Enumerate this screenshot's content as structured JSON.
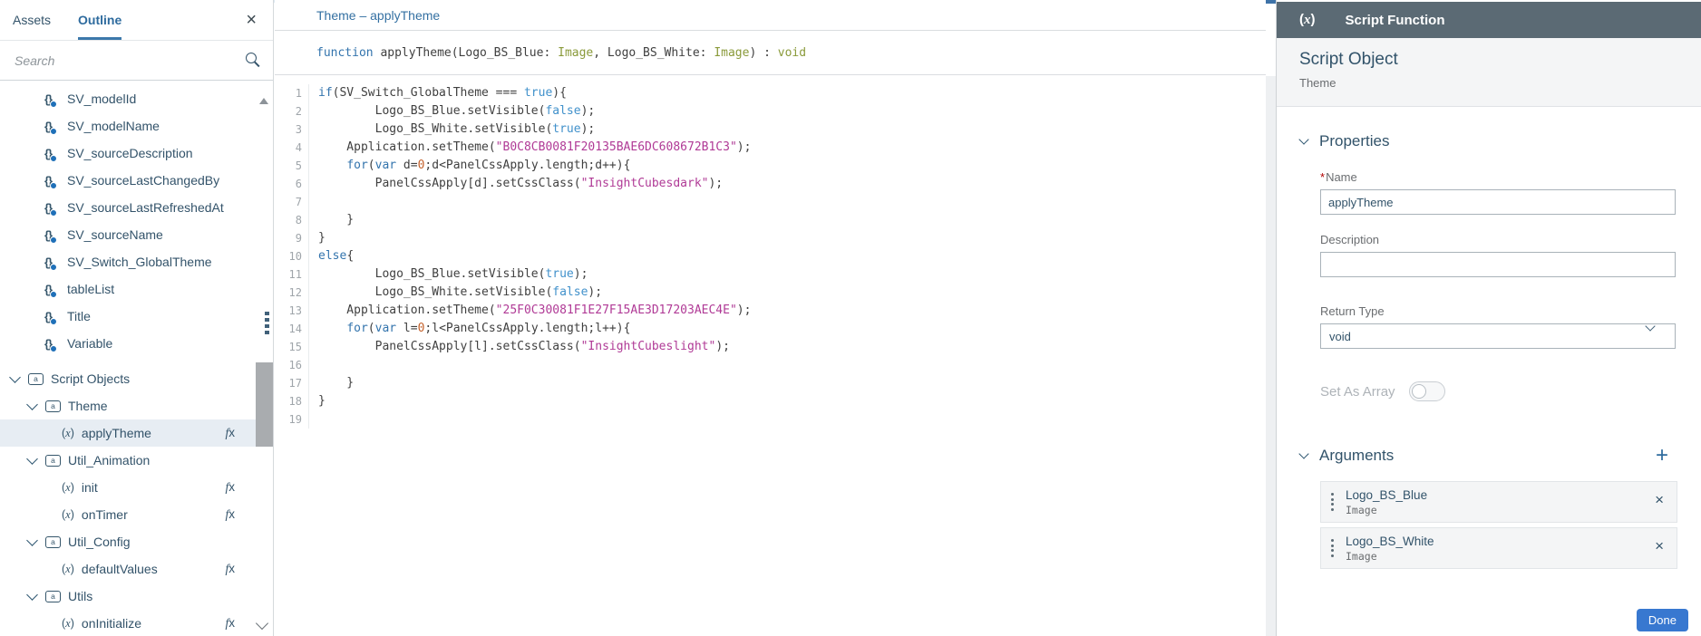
{
  "icons": {
    "variable": "{}",
    "object": "a",
    "function_open": "(",
    "function_x": "x",
    "function_close": ")",
    "fx_f": "f",
    "fx_x": "x",
    "remove": "×"
  },
  "sidebar": {
    "tabs": [
      {
        "label": "Assets",
        "active": false
      },
      {
        "label": "Outline",
        "active": true
      }
    ],
    "close_icon": "×",
    "search": {
      "placeholder": "Search"
    },
    "tree": [
      {
        "indent": 1,
        "icon": "variable",
        "label": "SV_modelId"
      },
      {
        "indent": 1,
        "icon": "variable",
        "label": "SV_modelName"
      },
      {
        "indent": 1,
        "icon": "variable",
        "label": "SV_sourceDescription"
      },
      {
        "indent": 1,
        "icon": "variable",
        "label": "SV_sourceLastChangedBy"
      },
      {
        "indent": 1,
        "icon": "variable",
        "label": "SV_sourceLastRefreshedAt"
      },
      {
        "indent": 1,
        "icon": "variable",
        "label": "SV_sourceName"
      },
      {
        "indent": 1,
        "icon": "variable",
        "label": "SV_Switch_GlobalTheme"
      },
      {
        "indent": 1,
        "icon": "variable",
        "label": "tableList"
      },
      {
        "indent": 1,
        "icon": "variable",
        "label": "Title"
      },
      {
        "indent": 1,
        "icon": "variable",
        "label": "Variable"
      },
      {
        "indent": 0,
        "chevron": true,
        "icon": "object",
        "label": "Script Objects",
        "gap": true
      },
      {
        "indent": 1,
        "chevron": true,
        "icon": "object",
        "label": "Theme"
      },
      {
        "indent": 2,
        "icon": "function",
        "label": "applyTheme",
        "fx": true,
        "selected": true
      },
      {
        "indent": 1,
        "chevron": true,
        "icon": "object",
        "label": "Util_Animation"
      },
      {
        "indent": 2,
        "icon": "function",
        "label": "init",
        "fx": true
      },
      {
        "indent": 2,
        "icon": "function",
        "label": "onTimer",
        "fx": true
      },
      {
        "indent": 1,
        "chevron": true,
        "icon": "object",
        "label": "Util_Config"
      },
      {
        "indent": 2,
        "icon": "function",
        "label": "defaultValues",
        "fx": true
      },
      {
        "indent": 1,
        "chevron": true,
        "icon": "object",
        "label": "Utils"
      },
      {
        "indent": 2,
        "icon": "function",
        "label": "onInitialize",
        "fx": true
      }
    ]
  },
  "editor": {
    "title": "Theme – applyTheme",
    "signature": [
      [
        "kw",
        "function"
      ],
      [
        "plain",
        " applyTheme(Logo_BS_Blue: "
      ],
      [
        "type",
        "Image"
      ],
      [
        "plain",
        ", Logo_BS_White: "
      ],
      [
        "type",
        "Image"
      ],
      [
        "plain",
        ") : "
      ],
      [
        "type",
        "void"
      ]
    ],
    "code_lines": [
      [
        [
          "kw",
          "if"
        ],
        [
          "plain",
          "(SV_Switch_GlobalTheme === "
        ],
        [
          "bool",
          "true"
        ],
        [
          "plain",
          "){"
        ]
      ],
      [
        [
          "plain",
          "        Logo_BS_Blue.setVisible("
        ],
        [
          "bool",
          "false"
        ],
        [
          "plain",
          ");"
        ]
      ],
      [
        [
          "plain",
          "        Logo_BS_White.setVisible("
        ],
        [
          "bool",
          "true"
        ],
        [
          "plain",
          ");"
        ]
      ],
      [
        [
          "plain",
          "    Application.setTheme("
        ],
        [
          "str",
          "\"B0C8CB0081F20135BAE6DC608672B1C3\""
        ],
        [
          "plain",
          ");"
        ]
      ],
      [
        [
          "plain",
          "    "
        ],
        [
          "kw",
          "for"
        ],
        [
          "plain",
          "("
        ],
        [
          "kw",
          "var"
        ],
        [
          "plain",
          " d="
        ],
        [
          "num",
          "0"
        ],
        [
          "plain",
          ";d<PanelCssApply.length;d++){"
        ]
      ],
      [
        [
          "plain",
          "        PanelCssApply[d].setCssClass("
        ],
        [
          "str",
          "\"InsightCubesdark\""
        ],
        [
          "plain",
          ");"
        ]
      ],
      [],
      [
        [
          "plain",
          "    }"
        ]
      ],
      [
        [
          "plain",
          "}"
        ]
      ],
      [
        [
          "kw",
          "else"
        ],
        [
          "plain",
          "{"
        ]
      ],
      [
        [
          "plain",
          "        Logo_BS_Blue.setVisible("
        ],
        [
          "bool",
          "true"
        ],
        [
          "plain",
          ");"
        ]
      ],
      [
        [
          "plain",
          "        Logo_BS_White.setVisible("
        ],
        [
          "bool",
          "false"
        ],
        [
          "plain",
          ");"
        ]
      ],
      [
        [
          "plain",
          "    Application.setTheme("
        ],
        [
          "str",
          "\"25F0C30081F1E27F15AE3D17203AEC4E\""
        ],
        [
          "plain",
          ");"
        ]
      ],
      [
        [
          "plain",
          "    "
        ],
        [
          "kw",
          "for"
        ],
        [
          "plain",
          "("
        ],
        [
          "kw",
          "var"
        ],
        [
          "plain",
          " l="
        ],
        [
          "num",
          "0"
        ],
        [
          "plain",
          ";l<PanelCssApply.length;l++){"
        ]
      ],
      [
        [
          "plain",
          "        PanelCssApply[l].setCssClass("
        ],
        [
          "str",
          "\"InsightCubeslight\""
        ],
        [
          "plain",
          ");"
        ]
      ],
      [],
      [
        [
          "plain",
          "    }"
        ]
      ],
      [
        [
          "plain",
          "}"
        ]
      ],
      []
    ]
  },
  "panel": {
    "header": {
      "title": "Script Function"
    },
    "subheader": {
      "title": "Script Object",
      "subtitle": "Theme"
    },
    "properties": {
      "section_title": "Properties",
      "name_label": "Name",
      "name_required": "*",
      "name_value": "applyTheme",
      "description_label": "Description",
      "description_value": "",
      "return_type_label": "Return Type",
      "return_type_value": "void",
      "set_as_array_label": "Set As Array"
    },
    "arguments": {
      "section_title": "Arguments",
      "add_icon": "+",
      "items": [
        {
          "name": "Logo_BS_Blue",
          "type": "Image"
        },
        {
          "name": "Logo_BS_White",
          "type": "Image"
        }
      ]
    },
    "done_label": "Done"
  }
}
